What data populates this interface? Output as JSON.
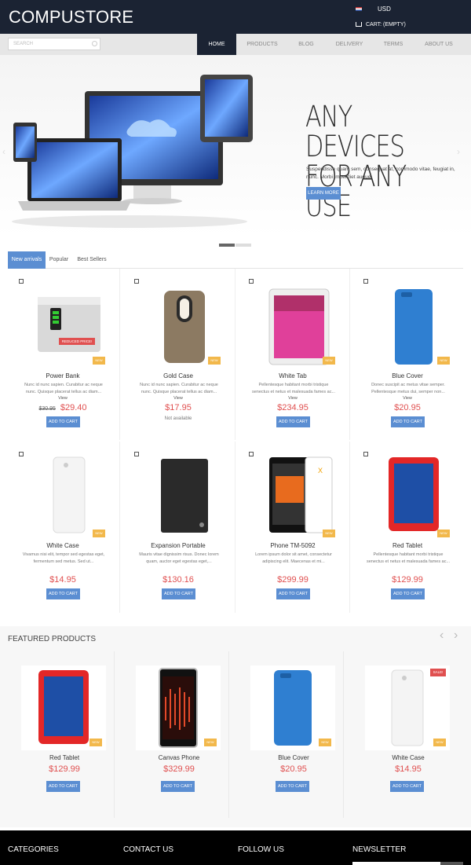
{
  "header": {
    "logo": "COMPUSTORE",
    "currency": "USD",
    "cart": "CART: (EMPTY)",
    "search_placeholder": "SEARCH",
    "nav": [
      "HOME",
      "PRODUCTS",
      "BLOG",
      "DELIVERY",
      "TERMS",
      "ABOUT US"
    ]
  },
  "hero": {
    "line1": "ANY DEVICES",
    "line2": "FOR ANY USE",
    "text": "Suspendisse quam sem, consequat at, commodo vitae, feugiat in, nunc. Morbi imperdiet augue.",
    "button": "LEARN MORE"
  },
  "tabs": [
    "New arrivals",
    "Popular",
    "Best Sellers"
  ],
  "products": [
    {
      "name": "Power Bank",
      "desc": "Nunc id nunc sapien. Curabitur ac neque nunc. Quisque placerat tellus ac diam...",
      "view": "View",
      "old_price": "$30.95",
      "price": "$29.40",
      "badge": "NEW",
      "sale_label": "REDUCED PRICE!",
      "button": "ADD TO CART",
      "icon": "power-bank"
    },
    {
      "name": "Gold Case",
      "desc": "Nunc id nunc sapien. Curabitur ac neque nunc. Quisque placerat tellus ac diam...",
      "view": "View",
      "price": "$17.95",
      "badge": "NEW",
      "availability": "Not available",
      "icon": "gold-case"
    },
    {
      "name": "White Tab",
      "desc": "Pellentesque habitant morbi tristique senectus et netus et malesuada fames ac...",
      "view": "View",
      "price": "$234.95",
      "badge": "NEW",
      "button": "ADD TO CART",
      "icon": "white-tablet"
    },
    {
      "name": "Blue Cover",
      "desc": "Donec suscipit ac metus vitae semper. Pellentesque metus dui, semper non...",
      "view": "View",
      "price": "$20.95",
      "badge": "NEW",
      "button": "ADD TO CART",
      "icon": "blue-cover"
    },
    {
      "name": "White Case",
      "desc": "Vivamus nisi elit, tempor sed egestas eget, fermentum sed metus. Sed ut...",
      "view": "View",
      "price": "$14.95",
      "badge": "NEW",
      "button": "ADD TO CART",
      "icon": "white-case"
    },
    {
      "name": "Expansion Portable",
      "desc": "Mauris vitae dignissim risus. Donec lorem quam, auctor eget egestas eget,...",
      "view": "View",
      "price": "$130.16",
      "button": "ADD TO CART",
      "icon": "hard-drive"
    },
    {
      "name": "Phone TM-5092",
      "desc": "Lorem ipsum dolor sit amet, consectetur adipiscing elit. Maecenas et mi...",
      "view": "View",
      "price": "$299.99",
      "badge": "NEW",
      "button": "ADD TO CART",
      "icon": "phone"
    },
    {
      "name": "Red Tablet",
      "desc": "Pellentesque habitant morbi tristique senectus et netus et malesuada fames ac...",
      "view": "View",
      "price": "$129.99",
      "badge": "NEW",
      "button": "ADD TO CART",
      "icon": "red-tablet"
    }
  ],
  "featured": {
    "title": "FEATURED PRODUCTS",
    "prev": "‹",
    "next": "›",
    "items": [
      {
        "name": "Red Tablet",
        "price": "$129.99",
        "badge": "NEW",
        "button": "ADD TO CART",
        "icon": "red-tablet"
      },
      {
        "name": "Canvas Phone",
        "price": "$329.99",
        "badge": "NEW",
        "button": "ADD TO CART",
        "icon": "canvas-phone"
      },
      {
        "name": "Blue Cover",
        "price": "$20.95",
        "badge": "NEW",
        "button": "ADD TO CART",
        "icon": "blue-cover"
      },
      {
        "name": "White Case",
        "price": "$14.95",
        "badge": "NEW",
        "sale_label": "SALE!",
        "button": "ADD TO CART",
        "icon": "white-case"
      }
    ]
  },
  "footer": {
    "headings": [
      "CATEGORIES",
      "CONTACT US",
      "FOLLOW US",
      "NEWSLETTER"
    ]
  },
  "colors": {
    "accent": "#5b8ed2",
    "price": "#e05050",
    "dark": "#1b2333",
    "badge": "#f2b84b"
  }
}
